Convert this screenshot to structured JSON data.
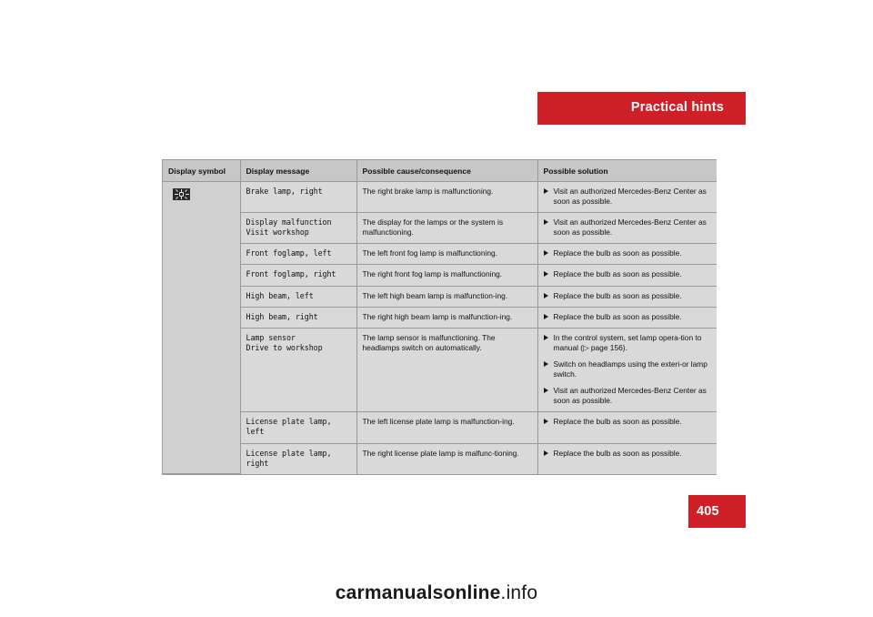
{
  "header": {
    "title": "Practical hints"
  },
  "page_number": "405",
  "watermark": {
    "bold_part": "carmanualsonline",
    "rest": ".info"
  },
  "table": {
    "columns": [
      "Display symbol",
      "Display message",
      "Possible cause/consequence",
      "Possible solution"
    ],
    "symbol_icon": "lamp-malfunction-icon",
    "rows": [
      {
        "message": "Brake lamp, right",
        "cause": "The right brake lamp is malfunctioning.",
        "solutions": [
          "Visit an authorized Mercedes-Benz Center as soon as possible."
        ]
      },
      {
        "message": "Display malfunction\nVisit workshop",
        "cause": "The display for the lamps or the system is malfunctioning.",
        "solutions": [
          "Visit an authorized Mercedes-Benz Center as soon as possible."
        ]
      },
      {
        "message": "Front foglamp, left",
        "cause": "The left front fog lamp is malfunctioning.",
        "solutions": [
          "Replace the bulb as soon as possible."
        ]
      },
      {
        "message": "Front foglamp, right",
        "cause": "The right front fog lamp is malfunctioning.",
        "solutions": [
          "Replace the bulb as soon as possible."
        ]
      },
      {
        "message": "High beam, left",
        "cause": "The left high beam lamp is malfunction-ing.",
        "solutions": [
          "Replace the bulb as soon as possible."
        ]
      },
      {
        "message": "High beam, right",
        "cause": "The right high beam lamp is malfunction-ing.",
        "solutions": [
          "Replace the bulb as soon as possible."
        ]
      },
      {
        "message": "Lamp sensor\nDrive to workshop",
        "cause": "The lamp sensor is malfunctioning. The headlamps switch on automatically.",
        "solutions": [
          "In the control system, set lamp opera-tion to manual (▷ page 156).",
          "Switch on headlamps using the exteri-or lamp switch.",
          "Visit an authorized Mercedes-Benz Center as soon as possible."
        ]
      },
      {
        "message": "License plate lamp,\nleft",
        "cause": "The left license plate lamp is malfunction-ing.",
        "solutions": [
          "Replace the bulb as soon as possible."
        ]
      },
      {
        "message": "License plate lamp,\nright",
        "cause": "The right license plate lamp is malfunc-tioning.",
        "solutions": [
          "Replace the bulb as soon as possible."
        ]
      }
    ]
  },
  "colors": {
    "accent": "#cf2028",
    "table_header": "#c7c7c7",
    "table_body": "#d9d9d9",
    "symbol_cell": "#d0d0d0",
    "page_bg": "#ffffff",
    "outer_bg": "#000000"
  }
}
